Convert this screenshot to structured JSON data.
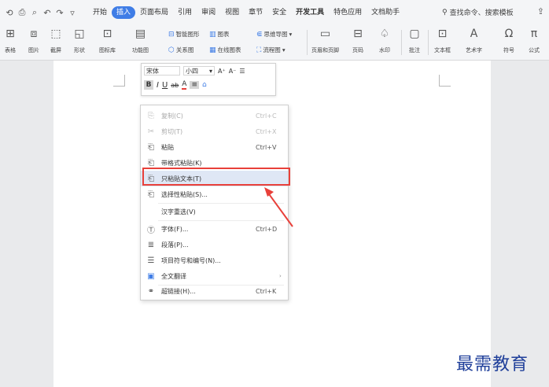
{
  "quick_access": [
    "⟲",
    "⎙",
    "⌕",
    "↶",
    "↷",
    "▿"
  ],
  "menus": [
    {
      "label": "开始",
      "active": false,
      "bold": false
    },
    {
      "label": "插入",
      "active": true,
      "bold": false
    },
    {
      "label": "页面布局",
      "active": false,
      "bold": false
    },
    {
      "label": "引用",
      "active": false,
      "bold": false
    },
    {
      "label": "审阅",
      "active": false,
      "bold": false
    },
    {
      "label": "视图",
      "active": false,
      "bold": false
    },
    {
      "label": "章节",
      "active": false,
      "bold": false
    },
    {
      "label": "安全",
      "active": false,
      "bold": false
    },
    {
      "label": "开发工具",
      "active": false,
      "bold": true
    },
    {
      "label": "特色应用",
      "active": false,
      "bold": false
    },
    {
      "label": "文档助手",
      "active": false,
      "bold": false
    }
  ],
  "search": {
    "icon": "search-icon",
    "label": "查找命令、搜索模板"
  },
  "ribbon": {
    "table": "表格",
    "picture": "图片",
    "screenshot": "截屏",
    "shape": "形状",
    "icon_lib": "图标库",
    "func_chart": "功能图",
    "smart_art": "智能图形",
    "chart": "图表",
    "mind_map": "思维导图",
    "relation": "关系图",
    "online_chart": "在线图表",
    "flow_chart": "流程图",
    "header_footer": "页眉和页脚",
    "page_number": "页码",
    "watermark": "水印",
    "comment": "批注",
    "text_box": "文本框",
    "art_text": "艺术字",
    "symbol": "符号",
    "formula": "公式"
  },
  "mini_toolbar": {
    "font": "宋体",
    "size": "小四",
    "grow": "A⁺",
    "shrink": "A⁻",
    "list": "☰",
    "bold": "B",
    "italic": "I",
    "underline": "U",
    "strike": "ab",
    "color": "A",
    "align": "≡",
    "eraser": "⌂"
  },
  "context_menu": [
    {
      "icon": "⎘",
      "label": "复制(C)",
      "shortcut": "Ctrl+C",
      "disabled": true
    },
    {
      "icon": "✂",
      "label": "剪切(T)",
      "shortcut": "Ctrl+X",
      "disabled": true
    },
    {
      "icon": "⎗",
      "label": "粘贴",
      "shortcut": "Ctrl+V",
      "disabled": false
    },
    {
      "icon": "⎗",
      "label": "带格式粘贴(K)",
      "shortcut": "",
      "disabled": false
    },
    {
      "icon": "⎗",
      "label": "只粘贴文本(T)",
      "shortcut": "",
      "disabled": false
    },
    {
      "icon": "⎗",
      "label": "选择性粘贴(S)...",
      "shortcut": "",
      "disabled": false
    },
    {
      "icon": "",
      "label": "汉字重选(V)",
      "shortcut": "",
      "disabled": false
    },
    {
      "icon": "Ⓣ",
      "label": "字体(F)...",
      "shortcut": "Ctrl+D",
      "disabled": false
    },
    {
      "icon": "≣",
      "label": "段落(P)...",
      "shortcut": "",
      "disabled": false
    },
    {
      "icon": "☰",
      "label": "项目符号和编号(N)...",
      "shortcut": "",
      "disabled": false
    },
    {
      "icon": "▣",
      "label": "全文翻译",
      "shortcut": "",
      "disabled": false
    },
    {
      "icon": "⚭",
      "label": "超链接(H)...",
      "shortcut": "Ctrl+K",
      "disabled": false
    }
  ],
  "watermark_text": "最需教育",
  "colors": {
    "accent": "#3f7de6",
    "highlight_box": "#e8403a",
    "watermark": "#1f3f9a"
  }
}
